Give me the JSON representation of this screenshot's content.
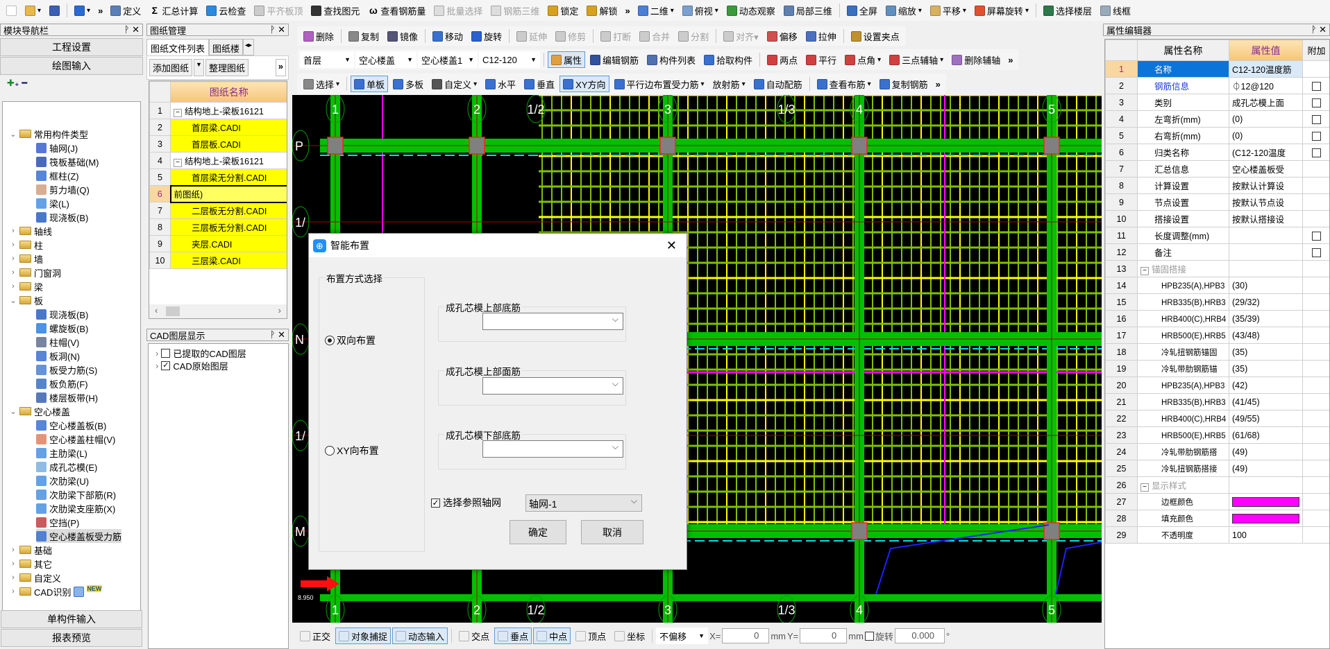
{
  "toolbar_main": [
    {
      "icon": "new-file-icon",
      "c": "#fff"
    },
    {
      "icon": "open-folder-icon",
      "c": "#e8b84a",
      "dd": true
    },
    {
      "icon": "save-icon",
      "c": "#3b5fb5"
    },
    {
      "sep": true
    },
    {
      "icon": "undo-icon",
      "c": "#2a6ad6",
      "dd": true
    },
    {
      "more": "»"
    },
    {
      "label": "定义",
      "icon": "define-icon",
      "c": "#5a7fb8"
    },
    {
      "label": "汇总计算",
      "icon": "sigma-icon",
      "glyph": "Σ"
    },
    {
      "label": "云检查",
      "icon": "cloud-check-icon",
      "c": "#2a8ae0"
    },
    {
      "label": "平齐板顶",
      "icon": "align-slab-icon",
      "c": "#ccc",
      "dis": true
    },
    {
      "label": "查找图元",
      "icon": "binoculars-icon",
      "c": "#333"
    },
    {
      "label": "查看钢筋量",
      "icon": "rebar-quantity-icon",
      "glyph": "ω"
    },
    {
      "label": "批量选择",
      "icon": "batch-select-icon",
      "c": "#ddd",
      "dis": true
    },
    {
      "label": "钢筋三维",
      "icon": "rebar-3d-icon",
      "c": "#ddd",
      "dis": true
    },
    {
      "label": "锁定",
      "icon": "lock-icon",
      "c": "#d8a020"
    },
    {
      "label": "解锁",
      "icon": "unlock-icon",
      "c": "#d8a020"
    },
    {
      "more": "»"
    },
    {
      "label": "二维",
      "icon": "2d-icon",
      "c": "#4a7fd8",
      "dd": true
    },
    {
      "label": "俯视",
      "icon": "top-view-icon",
      "c": "#7aa0d0",
      "dd": true
    },
    {
      "label": "动态观察",
      "icon": "orbit-icon",
      "c": "#3a9a3a"
    },
    {
      "label": "局部三维",
      "icon": "local-3d-icon",
      "c": "#6080b0"
    },
    {
      "sep": true
    },
    {
      "label": "全屏",
      "icon": "fullscreen-icon",
      "c": "#3a70c0"
    },
    {
      "label": "缩放",
      "icon": "zoom-icon",
      "c": "#6090c0",
      "dd": true
    },
    {
      "label": "平移",
      "icon": "pan-hand-icon",
      "c": "#d8b060",
      "dd": true
    },
    {
      "label": "屏幕旋转",
      "icon": "rotate-screen-icon",
      "c": "#e05030",
      "dd": true
    },
    {
      "sep": true
    },
    {
      "label": "选择楼层",
      "icon": "select-floor-icon",
      "c": "#2a7a4a"
    },
    {
      "label": "线框",
      "icon": "wireframe-icon",
      "c": "#9ab"
    }
  ],
  "nav": {
    "title": "模块导航栏",
    "btn_project": "工程设置",
    "btn_draw": "绘图输入",
    "btn_single": "单构件输入",
    "btn_report": "报表预览",
    "tree": [
      {
        "t": "常用构件类型",
        "lvl": 0,
        "folder": true,
        "open": true
      },
      {
        "t": "轴网(J)",
        "lvl": 1,
        "icon": "axis-grid-icon",
        "c": "#3a5fd0"
      },
      {
        "t": "筏板基础(M)",
        "lvl": 1,
        "icon": "raft-foundation-icon",
        "c": "#2a50b0"
      },
      {
        "t": "框柱(Z)",
        "lvl": 1,
        "icon": "column-icon",
        "c": "#3a70d0"
      },
      {
        "t": "剪力墙(Q)",
        "lvl": 1,
        "icon": "shear-wall-icon",
        "c": "#d0a080"
      },
      {
        "t": "梁(L)",
        "lvl": 1,
        "icon": "beam-icon",
        "c": "#4a90e0"
      },
      {
        "t": "现浇板(B)",
        "lvl": 1,
        "icon": "cast-slab-icon",
        "c": "#2a60c0"
      },
      {
        "t": "轴线",
        "lvl": 0,
        "folder": true
      },
      {
        "t": "柱",
        "lvl": 0,
        "folder": true
      },
      {
        "t": "墙",
        "lvl": 0,
        "folder": true
      },
      {
        "t": "门窗洞",
        "lvl": 0,
        "folder": true
      },
      {
        "t": "梁",
        "lvl": 0,
        "folder": true
      },
      {
        "t": "板",
        "lvl": 0,
        "folder": true,
        "open": true
      },
      {
        "t": "现浇板(B)",
        "lvl": 1,
        "icon": "cast-slab-icon",
        "c": "#2a60c0"
      },
      {
        "t": "螺旋板(B)",
        "lvl": 1,
        "icon": "spiral-slab-icon",
        "c": "#2a80e0"
      },
      {
        "t": "柱帽(V)",
        "lvl": 1,
        "icon": "column-cap-icon",
        "c": "#607090"
      },
      {
        "t": "板洞(N)",
        "lvl": 1,
        "icon": "slab-hole-icon",
        "c": "#3a70d0"
      },
      {
        "t": "板受力筋(S)",
        "lvl": 1,
        "icon": "slab-rebar-icon",
        "c": "#4a80d0"
      },
      {
        "t": "板负筋(F)",
        "lvl": 1,
        "icon": "negative-rebar-icon",
        "c": "#3a70c0"
      },
      {
        "t": "楼层板带(H)",
        "lvl": 1,
        "icon": "slab-strip-icon",
        "c": "#3a60b0"
      },
      {
        "t": "空心楼盖",
        "lvl": 0,
        "folder": true,
        "open": true
      },
      {
        "t": "空心楼盖板(B)",
        "lvl": 1,
        "icon": "hollow-slab-icon",
        "c": "#3a70d0"
      },
      {
        "t": "空心楼盖柱帽(V)",
        "lvl": 1,
        "icon": "hollow-cap-icon",
        "c": "#e08060"
      },
      {
        "t": "主肋梁(L)",
        "lvl": 1,
        "icon": "main-rib-icon",
        "c": "#4a90e0"
      },
      {
        "t": "成孔芯模(E)",
        "lvl": 1,
        "icon": "core-mold-icon",
        "c": "#7ab0e0"
      },
      {
        "t": "次肋梁(U)",
        "lvl": 1,
        "icon": "secondary-rib-icon",
        "c": "#4a90e0"
      },
      {
        "t": "次肋梁下部筋(R)",
        "lvl": 1,
        "icon": "rib-bottom-rebar-icon",
        "c": "#4a90e0"
      },
      {
        "t": "次肋梁支座筋(X)",
        "lvl": 1,
        "icon": "rib-support-rebar-icon",
        "c": "#4a90e0"
      },
      {
        "t": "空挡(P)",
        "lvl": 1,
        "icon": "gap-icon",
        "c": "#c04040"
      },
      {
        "t": "空心楼盖板受力筋",
        "lvl": 1,
        "icon": "hollow-slab-rebar-icon",
        "c": "#3a70d0",
        "sel": true
      },
      {
        "t": "基础",
        "lvl": 0,
        "folder": true
      },
      {
        "t": "其它",
        "lvl": 0,
        "folder": true
      },
      {
        "t": "自定义",
        "lvl": 0,
        "folder": true
      },
      {
        "t": "CAD识别",
        "lvl": 0,
        "folder": true,
        "badge": "NEW"
      }
    ]
  },
  "drawings": {
    "title": "图纸管理",
    "tab_active": "图纸文件列表",
    "tab_other": "图纸楼",
    "btn_add": "添加图纸",
    "btn_organize": "整理图纸",
    "more": "»",
    "col_name": "图纸名称",
    "rows": [
      {
        "n": "1",
        "name": "结构地上-梁板16121",
        "group": true
      },
      {
        "n": "2",
        "name": "首层梁.CADI",
        "yellow": true
      },
      {
        "n": "3",
        "name": "首层板.CADI",
        "yellow": true
      },
      {
        "n": "4",
        "name": "结构地上-梁板16121",
        "group": true
      },
      {
        "n": "5",
        "name": "首层梁无分割.CADI",
        "yellow": true
      },
      {
        "n": "6",
        "name": "前图纸)",
        "editing": true
      },
      {
        "n": "7",
        "name": "二层板无分割.CADI",
        "yellow": true
      },
      {
        "n": "8",
        "name": "三层板无分割.CADI",
        "yellow": true
      },
      {
        "n": "9",
        "name": "夹层.CADI",
        "yellow": true
      },
      {
        "n": "10",
        "name": "三层梁.CADI",
        "yellow": true
      }
    ]
  },
  "cad_layers": {
    "title": "CAD图层显示",
    "items": [
      {
        "t": "已提取的CAD图层",
        "checked": false
      },
      {
        "t": "CAD原始图层",
        "checked": true
      }
    ]
  },
  "edit_toolbar": [
    {
      "label": "删除",
      "icon": "delete-icon",
      "c": "#b060c0"
    },
    {
      "sep": true
    },
    {
      "label": "复制",
      "icon": "copy-icon",
      "c": "#888"
    },
    {
      "label": "镜像",
      "icon": "mirror-icon",
      "c": "#557"
    },
    {
      "sep": true
    },
    {
      "label": "移动",
      "icon": "move-icon",
      "c": "#3a70d0"
    },
    {
      "label": "旋转",
      "icon": "rotate-icon",
      "c": "#2a60d0"
    },
    {
      "sep": true
    },
    {
      "label": "延伸",
      "icon": "extend-icon",
      "c": "#ccc",
      "dis": true
    },
    {
      "label": "修剪",
      "icon": "trim-icon",
      "c": "#ccc",
      "dis": true
    },
    {
      "sep": true
    },
    {
      "label": "打断",
      "icon": "break-icon",
      "c": "#ccc",
      "dis": true
    },
    {
      "label": "合并",
      "icon": "merge-icon",
      "c": "#ccc",
      "dis": true
    },
    {
      "label": "分割",
      "icon": "split-icon",
      "c": "#ccc",
      "dis": true
    },
    {
      "sep": true
    },
    {
      "label": "对齐▾",
      "icon": "align-icon",
      "c": "#ccc",
      "dis": true
    },
    {
      "label": "偏移",
      "icon": "offset-icon",
      "c": "#d05050"
    },
    {
      "label": "拉伸",
      "icon": "stretch-icon",
      "c": "#4a70c0"
    },
    {
      "sep": true
    },
    {
      "label": "设置夹点",
      "icon": "grip-icon",
      "c": "#c09030"
    }
  ],
  "selectors": {
    "floor": "首层",
    "category": "空心楼盖",
    "type": "空心楼盖1",
    "component": "C12-120"
  },
  "prop_toolbar": [
    {
      "label": "属性",
      "icon": "properties-icon",
      "c": "#e0a040",
      "act": true
    },
    {
      "label": "编辑钢筋",
      "icon": "edit-rebar-icon",
      "c": "#3050a0"
    },
    {
      "label": "构件列表",
      "icon": "component-list-icon",
      "c": "#5070b0"
    },
    {
      "label": "拾取构件",
      "icon": "pick-component-icon",
      "c": "#3a70d0"
    },
    {
      "sep": true
    },
    {
      "label": "两点",
      "icon": "two-point-icon",
      "c": "#d04040"
    },
    {
      "label": "平行",
      "icon": "parallel-icon",
      "c": "#d04040"
    },
    {
      "label": "点角",
      "icon": "point-angle-icon",
      "c": "#d04040",
      "dd": true
    },
    {
      "label": "三点辅轴",
      "icon": "three-point-axis-icon",
      "c": "#d04040",
      "dd": true
    },
    {
      "label": "删除辅轴",
      "icon": "delete-axis-icon",
      "c": "#a070c0"
    },
    {
      "more": "»"
    }
  ],
  "draw_toolbar": [
    {
      "label": "选择",
      "icon": "select-cursor-icon",
      "c": "#888",
      "dd": true
    },
    {
      "sep": true
    },
    {
      "label": "单板",
      "icon": "single-slab-icon",
      "c": "#3a70d0",
      "act": true
    },
    {
      "label": "多板",
      "icon": "multi-slab-icon",
      "c": "#3a70d0"
    },
    {
      "label": "自定义",
      "icon": "custom-icon",
      "c": "#555",
      "dd": true
    },
    {
      "label": "水平",
      "icon": "horizontal-icon",
      "c": "#3a70d0"
    },
    {
      "label": "垂直",
      "icon": "vertical-icon",
      "c": "#3a70d0"
    },
    {
      "label": "XY方向",
      "icon": "xy-direction-icon",
      "c": "#3a70d0",
      "act": true
    },
    {
      "label": "平行边布置受力筋",
      "icon": "parallel-edge-icon",
      "c": "#3a70d0",
      "dd": true
    },
    {
      "label": "放射筋",
      "dd": true
    },
    {
      "label": "自动配筋",
      "icon": "auto-rebar-icon",
      "c": "#3a70d0"
    },
    {
      "sep": true
    },
    {
      "label": "查看布筋",
      "icon": "view-rebar-icon",
      "c": "#3a70d0",
      "dd": true
    },
    {
      "label": "复制钢筋",
      "icon": "copy-rebar-icon",
      "c": "#3a70d0"
    },
    {
      "more": "»"
    }
  ],
  "canvas": {
    "axes_x": [
      "1",
      "2",
      "1/2",
      "3",
      "1/3",
      "4",
      "5"
    ],
    "axes_y": [
      "P",
      "1/",
      "N",
      "1/",
      "M"
    ],
    "elevation": "8.950",
    "colors": {
      "bg": "#000000",
      "beam": "#00c000",
      "rebar_y": "#ffff00",
      "rebar_g": "#80c000",
      "column": "#808080",
      "column_border": "#ff2020",
      "dash": "#00e0e0",
      "magenta": "#ff00ff"
    }
  },
  "status_bar": {
    "items": [
      {
        "label": "正交",
        "icon": "orthogonal-icon"
      },
      {
        "label": "对象捕捉",
        "icon": "object-snap-icon",
        "act": true
      },
      {
        "label": "动态输入",
        "icon": "dynamic-input-icon",
        "act": true
      },
      {
        "sep": true
      },
      {
        "label": "交点",
        "icon": "intersection-icon"
      },
      {
        "label": "垂点",
        "icon": "perpendicular-icon",
        "act": true
      },
      {
        "label": "中点",
        "icon": "midpoint-icon",
        "act": true
      },
      {
        "label": "顶点",
        "icon": "vertex-icon"
      },
      {
        "label": "坐标",
        "icon": "coordinate-icon"
      }
    ],
    "offset_mode": "不偏移",
    "x_label": "X=",
    "x_value": "0",
    "unit": "mm",
    "y_label": "Y=",
    "y_value": "0",
    "rotate_label": "旋转",
    "rotate_value": "0.000",
    "degree": "°",
    "rotate_checked": false
  },
  "properties": {
    "title": "属性编辑器",
    "col_name": "属性名称",
    "col_value": "属性值",
    "col_extra": "附加",
    "rows": [
      {
        "n": "1",
        "name": "名称",
        "value": "C12-120温度筋",
        "selected": true
      },
      {
        "n": "2",
        "name": "钢筋信息",
        "value": "⏀12@120",
        "blue": true,
        "chk": true
      },
      {
        "n": "3",
        "name": "类别",
        "value": "成孔芯模上面",
        "chk": true
      },
      {
        "n": "4",
        "name": "左弯折(mm)",
        "value": "(0)",
        "chk": true
      },
      {
        "n": "5",
        "name": "右弯折(mm)",
        "value": "(0)",
        "chk": true
      },
      {
        "n": "6",
        "name": "归类名称",
        "value": "(C12-120温度",
        "chk": true
      },
      {
        "n": "7",
        "name": "汇总信息",
        "value": "空心楼盖板受"
      },
      {
        "n": "8",
        "name": "计算设置",
        "value": "按默认计算设"
      },
      {
        "n": "9",
        "name": "节点设置",
        "value": "按默认节点设"
      },
      {
        "n": "10",
        "name": "搭接设置",
        "value": "按默认搭接设"
      },
      {
        "n": "11",
        "name": "长度调整(mm)",
        "value": "",
        "chk": true
      },
      {
        "n": "12",
        "name": "备注",
        "value": "",
        "chk": true
      },
      {
        "n": "13",
        "name": "锚固搭接",
        "value": "",
        "group": true
      },
      {
        "n": "14",
        "name": "HPB235(A),HPB3",
        "value": "(30)",
        "child": true
      },
      {
        "n": "15",
        "name": "HRB335(B),HRB3",
        "value": "(29/32)",
        "child": true
      },
      {
        "n": "16",
        "name": "HRB400(C),HRB4",
        "value": "(35/39)",
        "child": true
      },
      {
        "n": "17",
        "name": "HRB500(E),HRB5",
        "value": "(43/48)",
        "child": true
      },
      {
        "n": "18",
        "name": "冷轧扭钢筋锚固",
        "value": "(35)",
        "child": true
      },
      {
        "n": "19",
        "name": "冷轧带肋钢筋锚",
        "value": "(35)",
        "child": true
      },
      {
        "n": "20",
        "name": "HPB235(A),HPB3",
        "value": "(42)",
        "child": true
      },
      {
        "n": "21",
        "name": "HRB335(B),HRB3",
        "value": "(41/45)",
        "child": true
      },
      {
        "n": "22",
        "name": "HRB400(C),HRB4",
        "value": "(49/55)",
        "child": true
      },
      {
        "n": "23",
        "name": "HRB500(E),HRB5",
        "value": "(61/68)",
        "child": true
      },
      {
        "n": "24",
        "name": "冷轧带肋钢筋搭",
        "value": "(49)",
        "child": true
      },
      {
        "n": "25",
        "name": "冷轧扭钢筋搭接",
        "value": "(49)",
        "child": true
      },
      {
        "n": "26",
        "name": "显示样式",
        "value": "",
        "group": true
      },
      {
        "n": "27",
        "name": "边框颜色",
        "value": "",
        "color": "#ff00ff",
        "child": true
      },
      {
        "n": "28",
        "name": "填充颜色",
        "value": "",
        "color": "#ff00ff",
        "child": true
      },
      {
        "n": "29",
        "name": "不透明度",
        "value": "100",
        "child": true
      }
    ]
  },
  "dialog": {
    "title": "智能布置",
    "group_mode": "布置方式选择",
    "radio_both": "双向布置",
    "radio_xy": "XY向布置",
    "selected_mode": "双向布置",
    "field_top_bottom": "成孔芯模上部底筋",
    "field_top_face": "成孔芯模上部面筋",
    "field_bottom_bottom": "成孔芯模下部底筋",
    "value_top_bottom": "",
    "value_top_face": "",
    "value_bottom_bottom": "",
    "ref_axis_label": "选择参照轴网",
    "ref_axis_checked": true,
    "ref_axis_value": "轴网-1",
    "ok": "确定",
    "cancel": "取消"
  }
}
